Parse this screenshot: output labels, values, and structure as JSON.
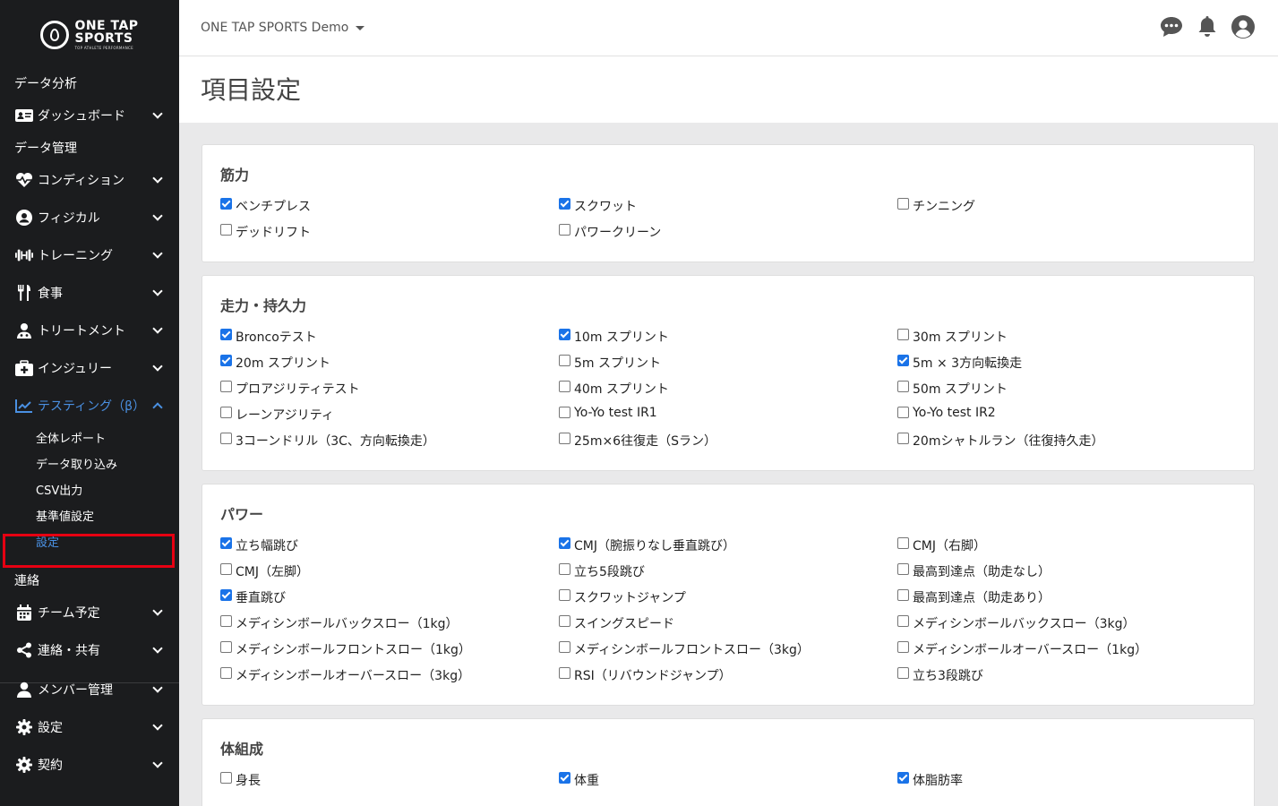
{
  "brand": {
    "main": "ONE TAP SPORTS",
    "line1": "ONE TAP",
    "line2": "SPORTS",
    "sub": "TOP ATHLETE PERFORMANCE"
  },
  "topbar": {
    "team": "ONE TAP SPORTS Demo"
  },
  "page": {
    "title": "項目設定"
  },
  "sidebar": {
    "section_analysis": "データ分析",
    "dashboard": "ダッシュボード",
    "section_data": "データ管理",
    "condition": "コンディション",
    "physical": "フィジカル",
    "training": "トレーニング",
    "meal": "食事",
    "treatment": "トリートメント",
    "injury": "インジュリー",
    "testing": "テスティング（β）",
    "sub": {
      "report": "全体レポート",
      "import": "データ取り込み",
      "csv": "CSV出力",
      "standard": "基準値設定",
      "settings": "設定"
    },
    "section_contact": "連絡",
    "schedule": "チーム予定",
    "share": "連絡・共有",
    "members": "メンバー管理",
    "settings": "設定",
    "contract": "契約"
  },
  "sections": [
    {
      "title": "筋力",
      "items": [
        {
          "label": "ベンチプレス",
          "checked": true
        },
        {
          "label": "スクワット",
          "checked": true
        },
        {
          "label": "チンニング",
          "checked": false
        },
        {
          "label": "デッドリフト",
          "checked": false
        },
        {
          "label": "パワークリーン",
          "checked": false
        }
      ]
    },
    {
      "title": "走力・持久力",
      "items": [
        {
          "label": "Broncoテスト",
          "checked": true
        },
        {
          "label": "10m スプリント",
          "checked": true
        },
        {
          "label": "30m スプリント",
          "checked": false
        },
        {
          "label": "20m スプリント",
          "checked": true
        },
        {
          "label": "5m スプリント",
          "checked": false
        },
        {
          "label": "5m × 3方向転換走",
          "checked": true
        },
        {
          "label": "プロアジリティテスト",
          "checked": false
        },
        {
          "label": "40m スプリント",
          "checked": false
        },
        {
          "label": "50m スプリント",
          "checked": false
        },
        {
          "label": "レーンアジリティ",
          "checked": false
        },
        {
          "label": "Yo-Yo test IR1",
          "checked": false
        },
        {
          "label": "Yo-Yo test IR2",
          "checked": false
        },
        {
          "label": "3コーンドリル（3C、方向転換走）",
          "checked": false
        },
        {
          "label": "25m×6往復走（Sラン）",
          "checked": false
        },
        {
          "label": "20mシャトルラン（往復持久走）",
          "checked": false
        }
      ]
    },
    {
      "title": "パワー",
      "items": [
        {
          "label": "立ち幅跳び",
          "checked": true
        },
        {
          "label": "CMJ（腕振りなし垂直跳び）",
          "checked": true
        },
        {
          "label": "CMJ（右脚）",
          "checked": false
        },
        {
          "label": "CMJ（左脚）",
          "checked": false
        },
        {
          "label": "立ち5段跳び",
          "checked": false
        },
        {
          "label": "最高到達点（助走なし）",
          "checked": false
        },
        {
          "label": "垂直跳び",
          "checked": true
        },
        {
          "label": "スクワットジャンプ",
          "checked": false
        },
        {
          "label": "最高到達点（助走あり）",
          "checked": false
        },
        {
          "label": "メディシンボールバックスロー（1kg）",
          "checked": false
        },
        {
          "label": "スイングスピード",
          "checked": false
        },
        {
          "label": "メディシンボールバックスロー（3kg）",
          "checked": false
        },
        {
          "label": "メディシンボールフロントスロー（1kg）",
          "checked": false
        },
        {
          "label": "メディシンボールフロントスロー（3kg）",
          "checked": false
        },
        {
          "label": "メディシンボールオーバースロー（1kg）",
          "checked": false
        },
        {
          "label": "メディシンボールオーバースロー（3kg）",
          "checked": false
        },
        {
          "label": "RSI（リバウンドジャンプ）",
          "checked": false
        },
        {
          "label": "立ち3段跳び",
          "checked": false
        }
      ]
    },
    {
      "title": "体組成",
      "items": [
        {
          "label": "身長",
          "checked": false
        },
        {
          "label": "体重",
          "checked": true
        },
        {
          "label": "体脂肪率",
          "checked": true
        }
      ]
    }
  ],
  "colors": {
    "accent": "#4a90e2",
    "sidebar_bg": "#1b1c1e",
    "highlight": "#e60012",
    "checkbox": "#1a73e8"
  }
}
